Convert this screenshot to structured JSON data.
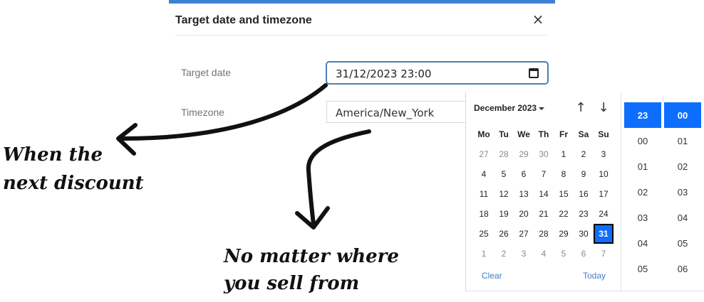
{
  "modal": {
    "title": "Target date and timezone",
    "close_symbol": "×"
  },
  "form": {
    "target_date_label": "Target date",
    "target_date_value": "31/12/2023 23:00",
    "timezone_label": "Timezone",
    "timezone_value": "America/New_York"
  },
  "datepicker": {
    "month_label": "December 2023",
    "prev_symbol": "↑",
    "next_symbol": "↓",
    "weekdays": [
      "Mo",
      "Tu",
      "We",
      "Th",
      "Fr",
      "Sa",
      "Su"
    ],
    "days": [
      {
        "label": "27",
        "other": true
      },
      {
        "label": "28",
        "other": true
      },
      {
        "label": "29",
        "other": true
      },
      {
        "label": "30",
        "other": true
      },
      {
        "label": "1"
      },
      {
        "label": "2"
      },
      {
        "label": "3"
      },
      {
        "label": "4"
      },
      {
        "label": "5"
      },
      {
        "label": "6"
      },
      {
        "label": "7"
      },
      {
        "label": "8"
      },
      {
        "label": "9"
      },
      {
        "label": "10"
      },
      {
        "label": "11"
      },
      {
        "label": "12"
      },
      {
        "label": "13"
      },
      {
        "label": "14"
      },
      {
        "label": "15"
      },
      {
        "label": "16"
      },
      {
        "label": "17"
      },
      {
        "label": "18"
      },
      {
        "label": "19"
      },
      {
        "label": "20"
      },
      {
        "label": "21"
      },
      {
        "label": "22"
      },
      {
        "label": "23"
      },
      {
        "label": "24"
      },
      {
        "label": "25"
      },
      {
        "label": "26"
      },
      {
        "label": "27"
      },
      {
        "label": "28"
      },
      {
        "label": "29"
      },
      {
        "label": "30"
      },
      {
        "label": "31",
        "selected": true
      },
      {
        "label": "1",
        "other": true
      },
      {
        "label": "2",
        "other": true
      },
      {
        "label": "3",
        "other": true
      },
      {
        "label": "4",
        "other": true
      },
      {
        "label": "5",
        "other": true
      },
      {
        "label": "6",
        "other": true
      },
      {
        "label": "7",
        "other": true
      }
    ],
    "clear_label": "Clear",
    "today_label": "Today",
    "hours": [
      "23",
      "00",
      "01",
      "02",
      "03",
      "04",
      "05"
    ],
    "minutes": [
      "00",
      "01",
      "02",
      "03",
      "04",
      "05",
      "06"
    ],
    "selected_hour": "23",
    "selected_minute": "00"
  },
  "annotations": {
    "left_line1": "When the",
    "left_line2": "next discount",
    "bottom_line1": "No matter where",
    "bottom_line2": "you sell from"
  },
  "colors": {
    "accent": "#0d6efd",
    "top_bar": "#3d82d0",
    "link": "#3d7fc7"
  }
}
